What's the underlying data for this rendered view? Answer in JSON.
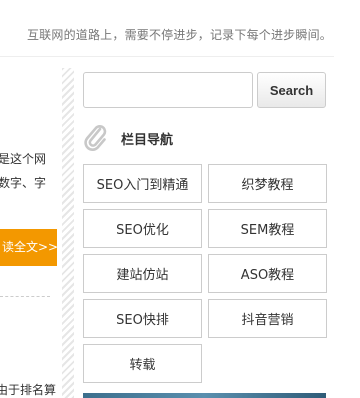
{
  "header": {
    "tagline": "互联网的道路上，需要不停进步，记录下每个进步瞬间。"
  },
  "left_column": {
    "line1": "是这个网",
    "line2": "数字、字",
    "read_more": "读全文>>",
    "line3": "由于排名算"
  },
  "search": {
    "placeholder": "",
    "value": "",
    "button_label": "Search"
  },
  "category_widget": {
    "icon": "paperclip-icon",
    "title": "栏目导航",
    "items": [
      {
        "label": "SEO入门到精通"
      },
      {
        "label": "织梦教程"
      },
      {
        "label": "SEO优化"
      },
      {
        "label": "SEM教程"
      },
      {
        "label": "建站仿站"
      },
      {
        "label": "ASO教程"
      },
      {
        "label": "SEO快排"
      },
      {
        "label": "抖音营销"
      },
      {
        "label": "转载"
      }
    ]
  },
  "colors": {
    "accent_orange": "#f39800",
    "border": "#cccccc",
    "text": "#333333",
    "muted_text": "#777777"
  }
}
